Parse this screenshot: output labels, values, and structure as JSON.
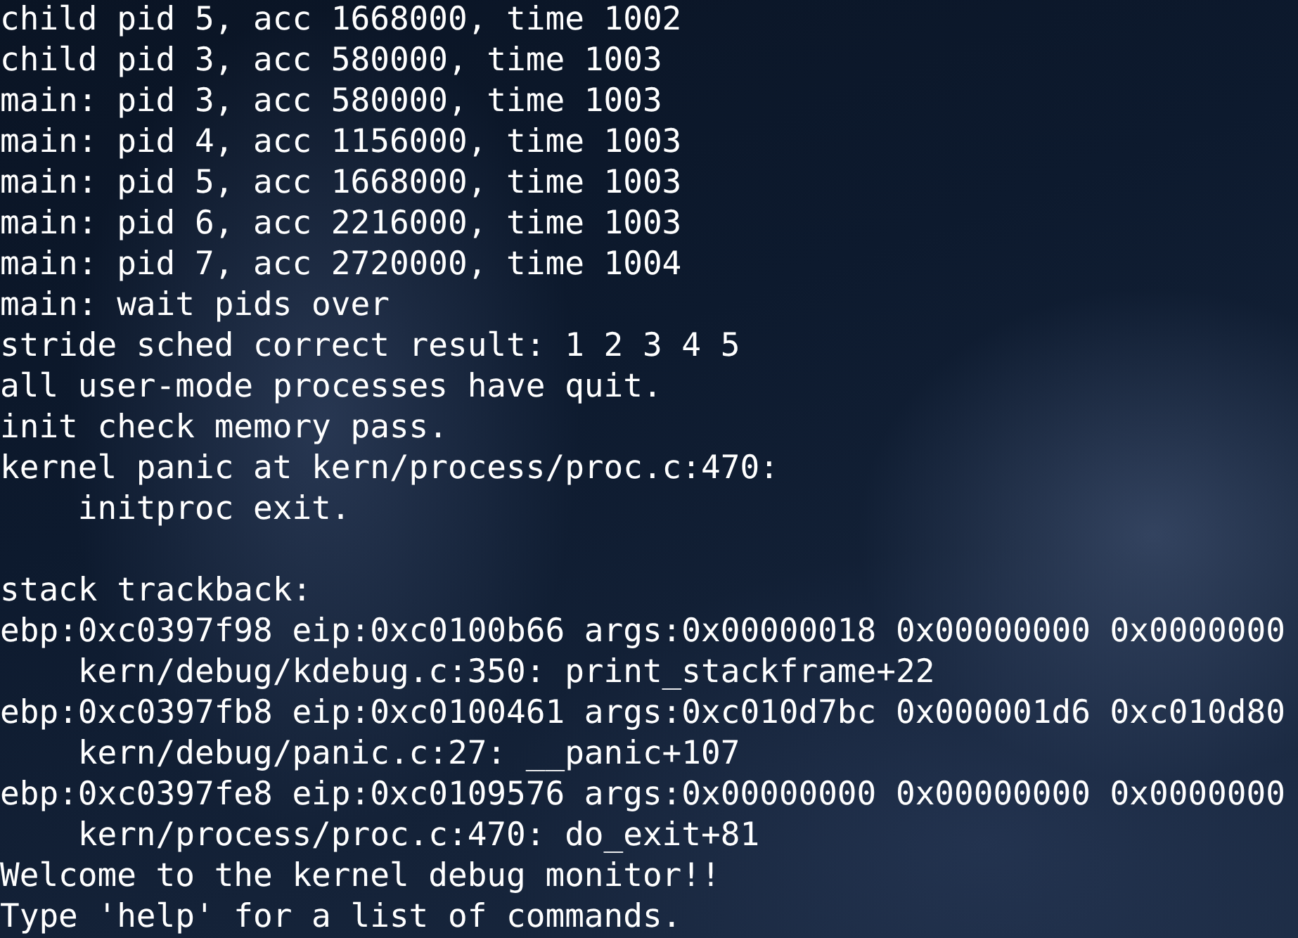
{
  "terminal": {
    "sections": [
      {
        "lines": [
          "child pid 5, acc 1668000, time 1002",
          "child pid 3, acc 580000, time 1003",
          "main: pid 3, acc 580000, time 1003",
          "main: pid 4, acc 1156000, time 1003",
          "main: pid 5, acc 1668000, time 1003",
          "main: pid 6, acc 2216000, time 1003",
          "main: pid 7, acc 2720000, time 1004",
          "main: wait pids over",
          "stride sched correct result: 1 2 3 4 5",
          "all user-mode processes have quit.",
          "init check memory pass.",
          "kernel panic at kern/process/proc.c:470:",
          "    initproc exit."
        ]
      },
      {
        "lines": [
          "stack trackback:",
          "ebp:0xc0397f98 eip:0xc0100b66 args:0x00000018 0x00000000 0x0000000",
          "    kern/debug/kdebug.c:350: print_stackframe+22",
          "ebp:0xc0397fb8 eip:0xc0100461 args:0xc010d7bc 0x000001d6 0xc010d80",
          "    kern/debug/panic.c:27: __panic+107",
          "ebp:0xc0397fe8 eip:0xc0109576 args:0x00000000 0x00000000 0x0000000",
          "    kern/process/proc.c:470: do_exit+81",
          "Welcome to the kernel debug monitor!!",
          "Type 'help' for a list of commands."
        ]
      }
    ]
  }
}
